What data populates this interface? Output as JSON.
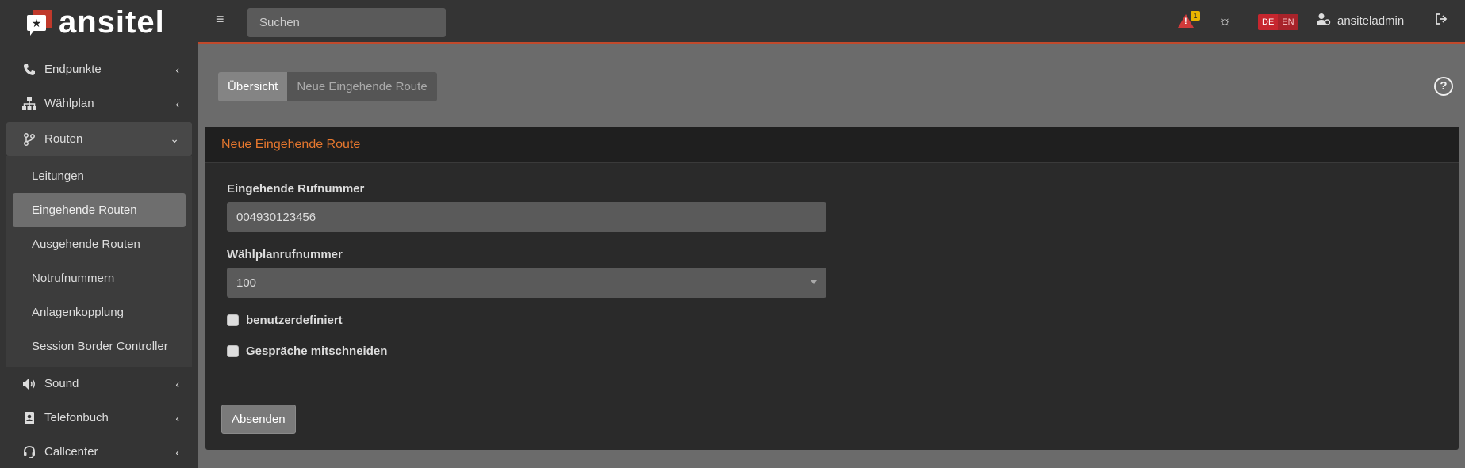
{
  "brand": {
    "name": "ansitel"
  },
  "sidebar": {
    "items": [
      {
        "label": "Endpunkte",
        "icon": "phone-icon"
      },
      {
        "label": "Wählplan",
        "icon": "sitemap-icon"
      },
      {
        "label": "Routen",
        "icon": "code-branch-icon",
        "open": true,
        "children": [
          {
            "label": "Leitungen"
          },
          {
            "label": "Eingehende Routen",
            "active": true
          },
          {
            "label": "Ausgehende Routen"
          },
          {
            "label": "Notrufnummern"
          },
          {
            "label": "Anlagenkopplung"
          },
          {
            "label": "Session Border Controller"
          }
        ]
      },
      {
        "label": "Sound",
        "icon": "volume-icon"
      },
      {
        "label": "Telefonbuch",
        "icon": "address-book-icon"
      },
      {
        "label": "Callcenter",
        "icon": "headset-icon"
      }
    ]
  },
  "topbar": {
    "search_placeholder": "Suchen",
    "alert_count": "1",
    "lang_de": "DE",
    "lang_en": "EN",
    "username": "ansiteladmin"
  },
  "breadcrumb": {
    "first": "Übersicht",
    "second": "Neue Eingehende Route"
  },
  "card": {
    "title": "Neue Eingehende Route",
    "fields": {
      "incoming_label": "Eingehende Rufnummer",
      "incoming_value": "004930123456",
      "dialplan_label": "Wählplanrufnummer",
      "dialplan_value": "100"
    },
    "checkboxes": {
      "custom": "benutzerdefiniert",
      "record": "Gespräche mitschneiden"
    },
    "submit_label": "Absenden"
  },
  "colors": {
    "accent": "#e6772e",
    "topbar_border": "#c0492b",
    "alert": "#d03a3a"
  }
}
